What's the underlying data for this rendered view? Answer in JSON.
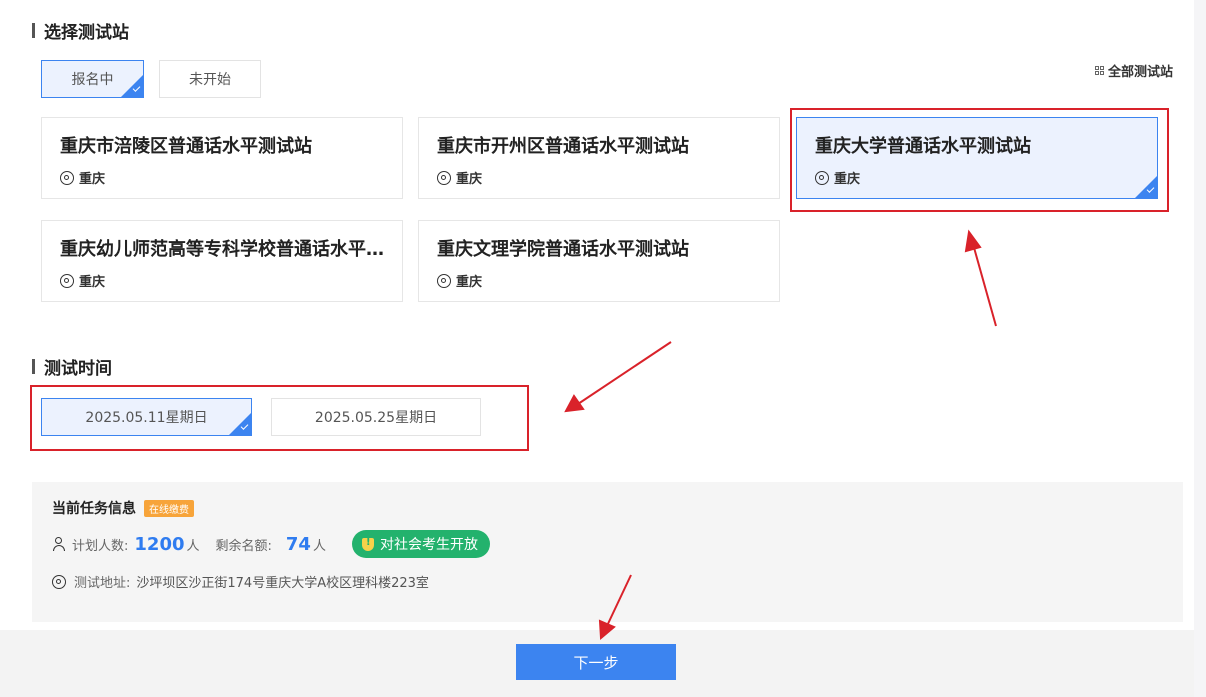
{
  "station_section": {
    "title": "选择测试站",
    "tabs": [
      {
        "label": "报名中",
        "selected": true
      },
      {
        "label": "未开始",
        "selected": false
      }
    ],
    "all_link": "全部测试站",
    "stations": [
      {
        "name": "重庆市涪陵区普通话水平测试站",
        "location": "重庆",
        "selected": false
      },
      {
        "name": "重庆市开州区普通话水平测试站",
        "location": "重庆",
        "selected": false
      },
      {
        "name": "重庆大学普通话水平测试站",
        "location": "重庆",
        "selected": true
      },
      {
        "name": "重庆幼儿师范高等专科学校普通话水平测试站",
        "location": "重庆",
        "selected": false
      },
      {
        "name": "重庆文理学院普通话水平测试站",
        "location": "重庆",
        "selected": false
      }
    ]
  },
  "time_section": {
    "title": "测试时间",
    "dates": [
      {
        "label": "2025.05.11星期日",
        "selected": true
      },
      {
        "label": "2025.05.25星期日",
        "selected": false
      }
    ]
  },
  "task_info": {
    "title": "当前任务信息",
    "pay_badge": "在线缴费",
    "planned_label": "计划人数:",
    "planned_value": "1200",
    "planned_unit": "人",
    "remaining_label": "剩余名额:",
    "remaining_value": "74",
    "remaining_unit": "人",
    "open_badge": "对社会考生开放",
    "address_label": "测试地址:",
    "address_value": "沙坪坝区沙正街174号重庆大学A校区理科楼223室"
  },
  "footer": {
    "next_label": "下一步"
  },
  "colors": {
    "accent": "#3c84f0",
    "annotation": "#d9222a",
    "open_badge": "#23b26d",
    "pay_badge": "#f7a43a"
  }
}
